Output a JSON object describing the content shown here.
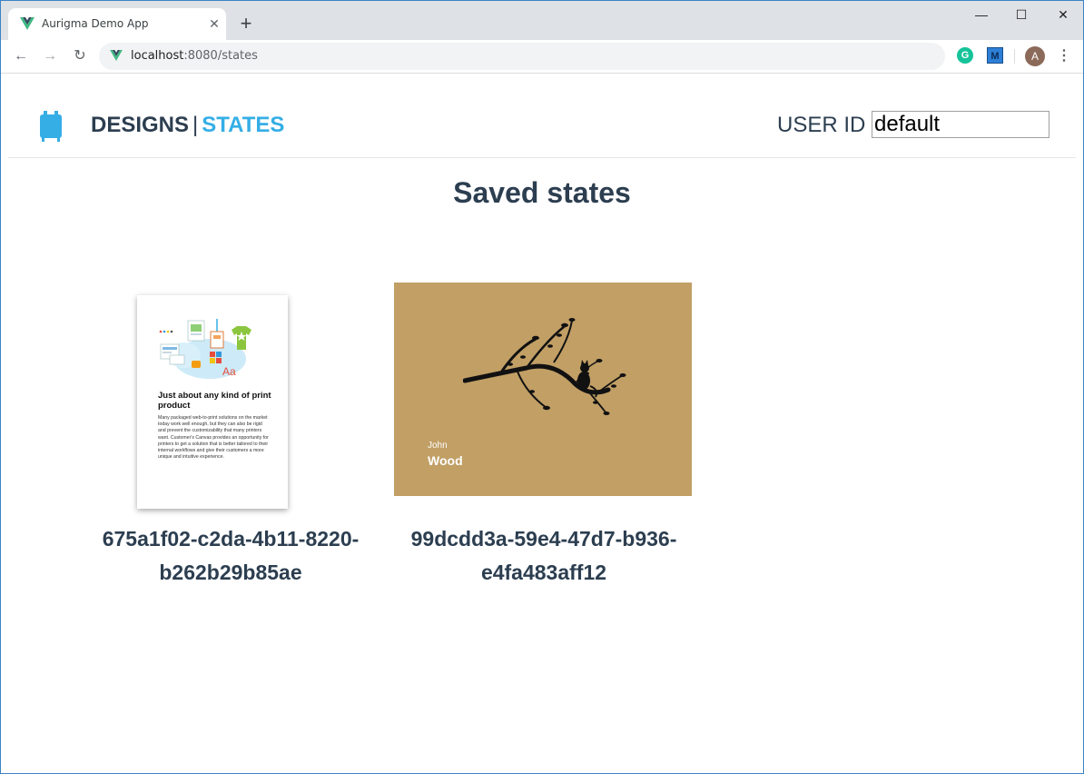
{
  "browser": {
    "tab_title": "Aurigma Demo App",
    "tab_close": "✕",
    "new_tab": "+",
    "url_host": "localhost",
    "url_path": ":8080/states",
    "avatar_letter": "A",
    "ext_grammarly": "G",
    "ext_m": "M",
    "back_icon": "←",
    "forward_icon": "→",
    "reload_icon": "↻",
    "menu_icon": "⋮",
    "minimize_icon": "—",
    "maximize_icon": "☐",
    "close_icon": "✕"
  },
  "header": {
    "nav_designs": "DESIGNS",
    "nav_separator": "|",
    "nav_states": "STATES",
    "user_id_label": "USER ID",
    "user_id_value": "default"
  },
  "main": {
    "title": "Saved states",
    "states": [
      {
        "id_line1": "675a1f02-c2da-4b11-8220-",
        "id_line2": "b262b29b85ae",
        "preview_heading": "Just about any kind of print product",
        "preview_body": "Many packaged web-to-print solutions on the market today work well enough, but they can also be rigid and prevent the customizability that many printers want. Customer's Canvas provides an opportunity for printers to get a solution that is better tailored to their internal workflows and give their customers a more unique and intuitive experience."
      },
      {
        "id_line1": "99dcdd3a-59e4-47d7-b936-",
        "id_line2": "e4fa483aff12",
        "preview_first_name": "John",
        "preview_last_name": "Wood"
      }
    ]
  },
  "colors": {
    "accent": "#35aee6",
    "text": "#2c3e50",
    "card2_background": "#c19f65"
  }
}
